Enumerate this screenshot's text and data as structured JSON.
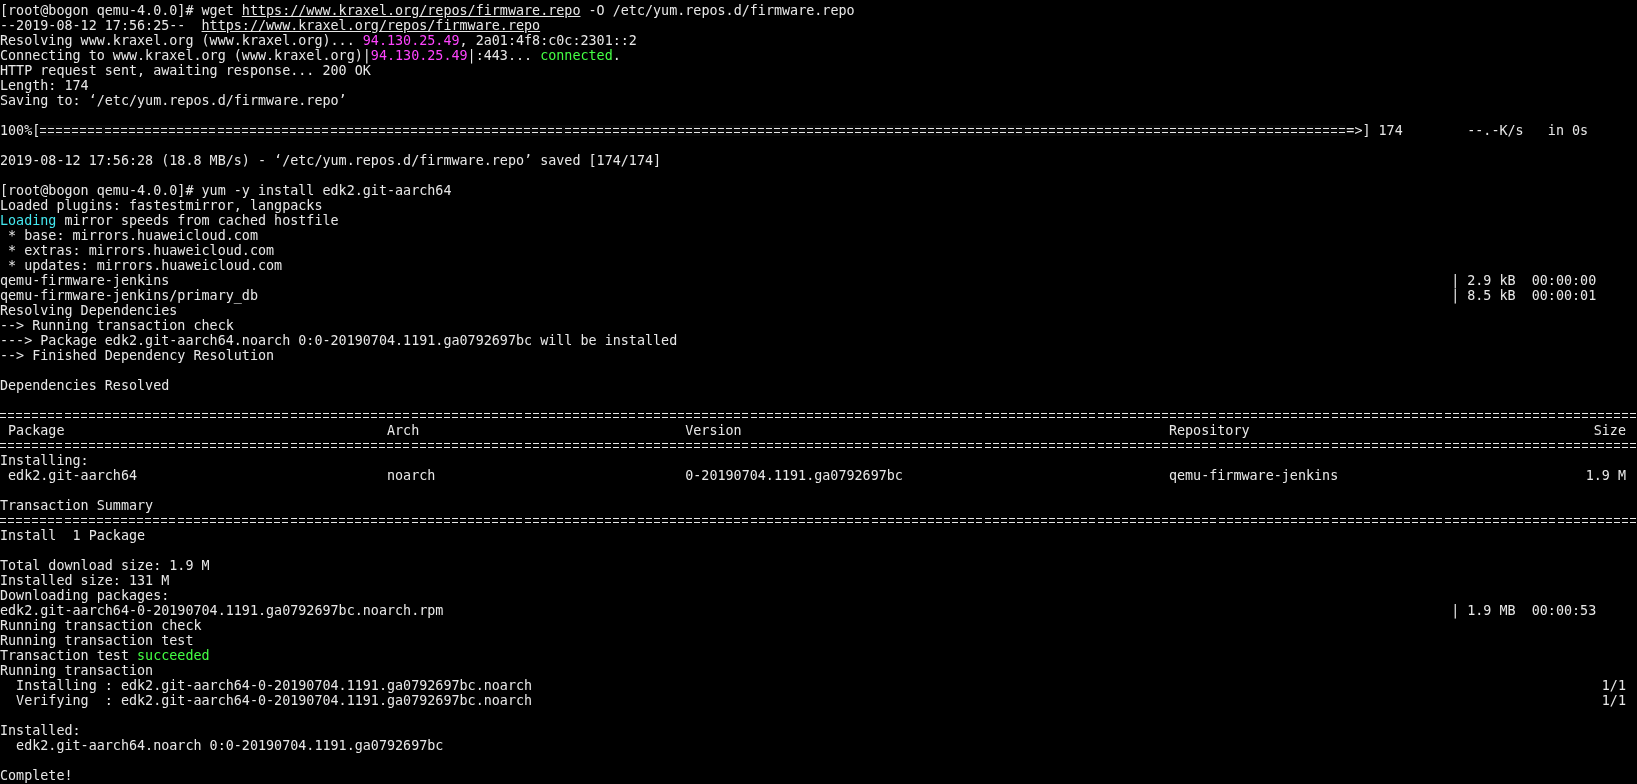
{
  "terminal": {
    "lines": [
      {
        "kind": "text",
        "spans": [
          {
            "text": "[root@bogon qemu-4.0.0]# wget "
          },
          {
            "text": "https://www.kraxel.org/repos/firmware.repo",
            "kind": "link"
          },
          {
            "text": " -O /etc/yum.repos.d/firmware.repo"
          }
        ]
      },
      {
        "kind": "text",
        "spans": [
          {
            "text": "--2019-08-12 17:56:25--  "
          },
          {
            "text": "https://www.kraxel.org/repos/firmware.repo",
            "kind": "link"
          }
        ]
      },
      {
        "kind": "text",
        "spans": [
          {
            "text": "Resolving www.kraxel.org (www.kraxel.org)... "
          },
          {
            "text": "94.130.25.49",
            "kind": "ip"
          },
          {
            "text": ", 2a01:4f8:c0c:2301::2"
          }
        ]
      },
      {
        "kind": "text",
        "spans": [
          {
            "text": "Connecting to www.kraxel.org (www.kraxel.org)|"
          },
          {
            "text": "94.130.25.49",
            "kind": "ip"
          },
          {
            "text": "|:443... "
          },
          {
            "text": "connected",
            "kind": "ok"
          },
          {
            "text": "."
          }
        ]
      },
      {
        "kind": "text",
        "spans": [
          {
            "text": "HTTP request sent, awaiting response... 200 OK"
          }
        ]
      },
      {
        "kind": "text",
        "spans": [
          {
            "text": "Length: 174"
          }
        ]
      },
      {
        "kind": "text",
        "spans": [
          {
            "text": "Saving to: ‘/etc/yum.repos.d/firmware.repo’"
          }
        ]
      },
      {
        "kind": "blank"
      },
      {
        "kind": "progress",
        "percent": "100%",
        "open": "[",
        "close": "=>]",
        "level": 1,
        "size": "174",
        "speed": "--.-K/s",
        "eta": "in 0s"
      },
      {
        "kind": "blank"
      },
      {
        "kind": "text",
        "spans": [
          {
            "text": "2019-08-12 17:56:28 (18.8 MB/s) - ‘/etc/yum.repos.d/firmware.repo’ saved [174/174]"
          }
        ]
      },
      {
        "kind": "blank"
      },
      {
        "kind": "text",
        "spans": [
          {
            "text": "[root@bogon qemu-4.0.0]# yum -y install edk2.git-aarch64"
          }
        ]
      },
      {
        "kind": "text",
        "spans": [
          {
            "text": "Loaded plugins: fastestmirror, langpacks"
          }
        ]
      },
      {
        "kind": "text",
        "spans": [
          {
            "text": "Loading",
            "kind": "info"
          },
          {
            "text": " mirror speeds from cached hostfile"
          }
        ]
      },
      {
        "kind": "text",
        "spans": [
          {
            "text": " * base: mirrors.huaweicloud.com"
          }
        ]
      },
      {
        "kind": "text",
        "spans": [
          {
            "text": " * extras: mirrors.huaweicloud.com"
          }
        ]
      },
      {
        "kind": "text",
        "spans": [
          {
            "text": " * updates: mirrors.huaweicloud.com"
          }
        ]
      },
      {
        "kind": "meta",
        "spans": [
          {
            "text": "qemu-firmware-jenkins"
          }
        ],
        "meta": "| 2.9 kB  00:00:00"
      },
      {
        "kind": "meta",
        "spans": [
          {
            "text": "qemu-firmware-jenkins/primary_db"
          }
        ],
        "meta": "| 8.5 kB  00:00:01"
      },
      {
        "kind": "text",
        "spans": [
          {
            "text": "Resolving Dependencies"
          }
        ]
      },
      {
        "kind": "text",
        "spans": [
          {
            "text": "--> Running transaction check"
          }
        ]
      },
      {
        "kind": "text",
        "spans": [
          {
            "text": "---> Package edk2.git-aarch64.noarch 0:0-20190704.1191.ga0792697bc will be installed"
          }
        ]
      },
      {
        "kind": "text",
        "spans": [
          {
            "text": "--> Finished Dependency Resolution"
          }
        ]
      },
      {
        "kind": "blank"
      },
      {
        "kind": "text",
        "spans": [
          {
            "text": "Dependencies Resolved"
          }
        ]
      },
      {
        "kind": "blank"
      },
      {
        "kind": "rule"
      },
      {
        "kind": "row",
        "cells": [
          "Package",
          "Arch",
          "Version",
          "Repository",
          "Size"
        ]
      },
      {
        "kind": "rule"
      },
      {
        "kind": "text",
        "spans": [
          {
            "text": "Installing:"
          }
        ]
      },
      {
        "kind": "row",
        "cells": [
          "edk2.git-aarch64",
          "noarch",
          "0-20190704.1191.ga0792697bc",
          "qemu-firmware-jenkins",
          "1.9 M"
        ]
      },
      {
        "kind": "blank"
      },
      {
        "kind": "text",
        "spans": [
          {
            "text": "Transaction Summary"
          }
        ]
      },
      {
        "kind": "rule"
      },
      {
        "kind": "text",
        "spans": [
          {
            "text": "Install  1 Package"
          }
        ]
      },
      {
        "kind": "blank"
      },
      {
        "kind": "text",
        "spans": [
          {
            "text": "Total download size: 1.9 M"
          }
        ]
      },
      {
        "kind": "text",
        "spans": [
          {
            "text": "Installed size: 131 M"
          }
        ]
      },
      {
        "kind": "text",
        "spans": [
          {
            "text": "Downloading packages:"
          }
        ]
      },
      {
        "kind": "meta",
        "spans": [
          {
            "text": "edk2.git-aarch64-0-20190704.1191.ga0792697bc.noarch.rpm"
          }
        ],
        "meta": "| 1.9 MB  00:00:53"
      },
      {
        "kind": "text",
        "spans": [
          {
            "text": "Running transaction check"
          }
        ]
      },
      {
        "kind": "text",
        "spans": [
          {
            "text": "Running transaction test"
          }
        ]
      },
      {
        "kind": "text",
        "spans": [
          {
            "text": "Transaction test "
          },
          {
            "text": "succeeded",
            "kind": "ok"
          }
        ]
      },
      {
        "kind": "text",
        "spans": [
          {
            "text": "Running transaction"
          }
        ]
      },
      {
        "kind": "count",
        "spans": [
          {
            "text": "  Installing : edk2.git-aarch64-0-20190704.1191.ga0792697bc.noarch"
          }
        ],
        "count": "1/1"
      },
      {
        "kind": "count",
        "spans": [
          {
            "text": "  Verifying  : edk2.git-aarch64-0-20190704.1191.ga0792697bc.noarch"
          }
        ],
        "count": "1/1"
      },
      {
        "kind": "blank"
      },
      {
        "kind": "text",
        "spans": [
          {
            "text": "Installed:"
          }
        ]
      },
      {
        "kind": "text",
        "spans": [
          {
            "text": "  edk2.git-aarch64.noarch 0:0-20190704.1191.ga0792697bc"
          }
        ]
      },
      {
        "kind": "blank"
      },
      {
        "kind": "text",
        "spans": [
          {
            "text": "Complete!"
          }
        ]
      }
    ]
  }
}
